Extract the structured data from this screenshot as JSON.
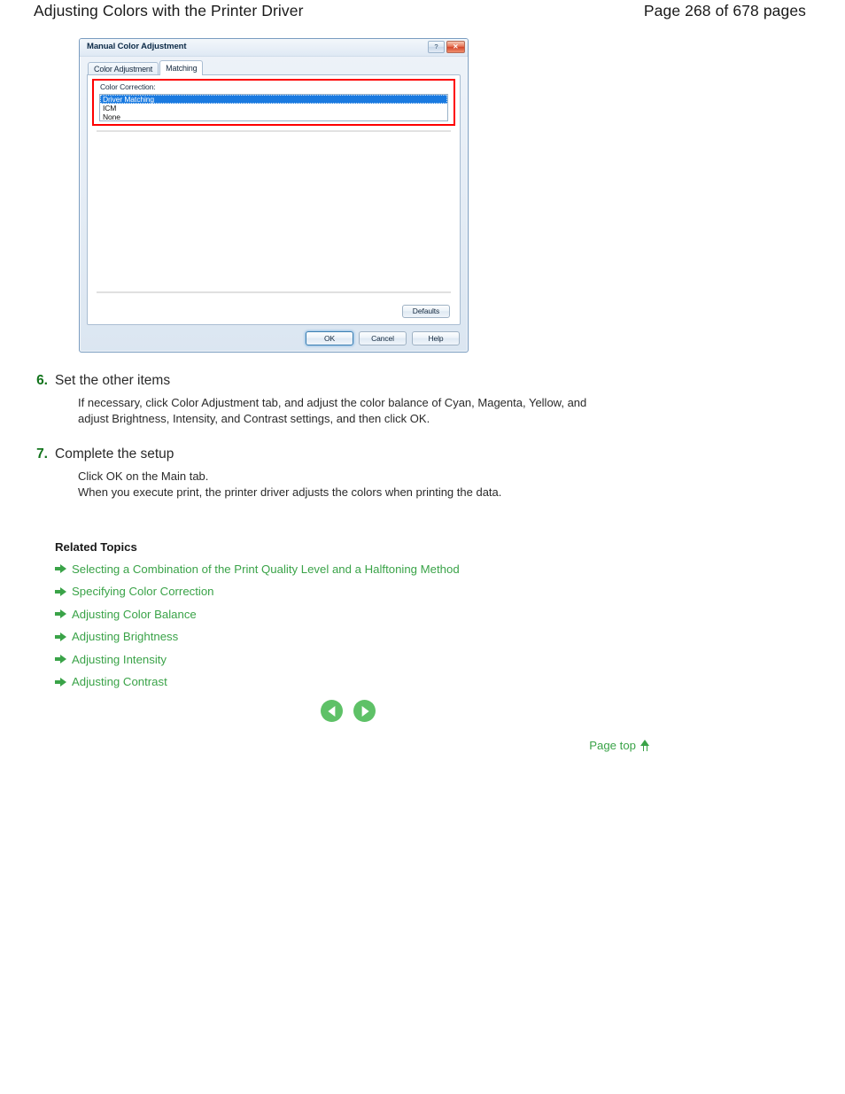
{
  "header": {
    "title": "Adjusting Colors with the Printer Driver",
    "page_indicator": "Page 268 of 678 pages"
  },
  "dialog": {
    "title": "Manual Color Adjustment",
    "titlebar_buttons": {
      "help_glyph": "?",
      "close_glyph": "✕"
    },
    "tabs": [
      {
        "label": "Color Adjustment",
        "active": false
      },
      {
        "label": "Matching",
        "active": true
      }
    ],
    "color_correction": {
      "label": "Color Correction:",
      "options": [
        "Driver Matching",
        "ICM",
        "None"
      ],
      "selected": "Driver Matching",
      "highlight_color": "#fe0000",
      "selection_color": "#1a7ae0"
    },
    "defaults_button": "Defaults",
    "footer_buttons": [
      {
        "label": "OK",
        "default": true
      },
      {
        "label": "Cancel",
        "default": false
      },
      {
        "label": "Help",
        "default": false
      }
    ]
  },
  "steps": [
    {
      "number": "6.",
      "heading": "Set the other items",
      "lines": [
        "If necessary, click Color Adjustment tab, and adjust the color balance of Cyan, Magenta, Yellow, and",
        "adjust Brightness, Intensity, and Contrast settings, and then click OK."
      ]
    },
    {
      "number": "7.",
      "heading": "Complete the setup",
      "lines": [
        "Click OK on the Main tab.",
        "When you execute print, the printer driver adjusts the colors when printing the data."
      ]
    }
  ],
  "related": {
    "title": "Related Topics",
    "links": [
      "Selecting a Combination of the Print Quality Level and a Halftoning Method",
      "Specifying Color Correction",
      "Adjusting Color Balance",
      "Adjusting Brightness",
      "Adjusting Intensity",
      "Adjusting Contrast"
    ],
    "link_color": "#3aa348"
  },
  "navigation": {
    "previous_label": "Previous page",
    "next_label": "Next page"
  },
  "page_top": {
    "label": "Page top"
  },
  "colors": {
    "step_number": "#12741c",
    "link_green": "#3aa348",
    "highlight_red": "#fe0000",
    "listbox_selection": "#1a7ae0"
  }
}
